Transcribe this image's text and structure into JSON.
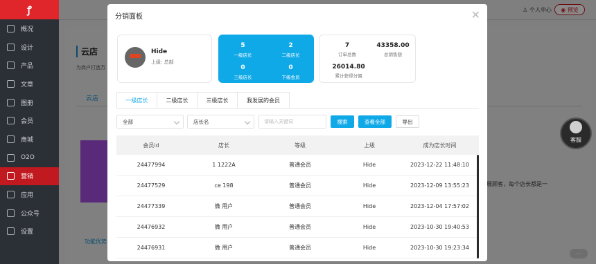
{
  "sidebar": {
    "items": [
      {
        "label": "概况",
        "icon": "monitor-icon"
      },
      {
        "label": "设计",
        "icon": "palette-icon"
      },
      {
        "label": "产品",
        "icon": "box-icon"
      },
      {
        "label": "文章",
        "icon": "document-icon"
      },
      {
        "label": "图册",
        "icon": "image-icon"
      },
      {
        "label": "会员",
        "icon": "user-icon"
      },
      {
        "label": "商城",
        "icon": "cart-icon"
      },
      {
        "label": "O2O",
        "icon": "o2o-icon"
      },
      {
        "label": "营销",
        "icon": "chart-icon"
      },
      {
        "label": "应用",
        "icon": "grid-icon"
      },
      {
        "label": "公众号",
        "icon": "id-card-icon"
      },
      {
        "label": "设置",
        "icon": "gear-icon"
      }
    ]
  },
  "topbar": {
    "user": "个人中心",
    "preview": "预览"
  },
  "page": {
    "title": "云店",
    "subtitle": "为商户打造万",
    "tab": "云店",
    "feature_link": "功能优势",
    "desc": "发展顾客，每个店长都是一"
  },
  "kefu": {
    "label": "客服"
  },
  "modal": {
    "title": "分销面板",
    "user": {
      "name": "Hide",
      "superior": "上级: 总部"
    },
    "stats_blue": [
      {
        "value": "5",
        "label": "一级店长"
      },
      {
        "value": "2",
        "label": "二级店长"
      },
      {
        "value": "0",
        "label": "三级店长"
      },
      {
        "value": "0",
        "label": "下级会员"
      }
    ],
    "stats_white": {
      "orders": {
        "value": "7",
        "label": "订单总数"
      },
      "sales": {
        "value": "43358.00",
        "label": "总销售额"
      },
      "commission": {
        "value": "26014.80",
        "label": "累计获得分佣"
      }
    },
    "tabs": [
      "一级店长",
      "二级店长",
      "三级店长",
      "我发展的会员"
    ],
    "filters": {
      "select1": "全部",
      "select2": "店长名",
      "search_placeholder": "请输入关键词",
      "search_btn": "搜索",
      "view_all_btn": "查看全部",
      "export_btn": "导出"
    },
    "table": {
      "columns": [
        "会员id",
        "店长",
        "等级",
        "上级",
        "成为店长时间"
      ],
      "rows": [
        [
          "24477994",
          "1 1222A",
          "普通会员",
          "Hide",
          "2023-12-22 11:48:10"
        ],
        [
          "24477529",
          "ce 198",
          "普通会员",
          "Hide",
          "2023-12-09 13:55:23"
        ],
        [
          "24477339",
          "微 用户",
          "普通会员",
          "Hide",
          "2023-12-04 17:57:02"
        ],
        [
          "24476932",
          "微 用户",
          "普通会员",
          "Hide",
          "2023-10-30 19:40:53"
        ],
        [
          "24476931",
          "微 用户",
          "普通会员",
          "Hide",
          "2023-10-30 19:23:34"
        ]
      ]
    }
  }
}
